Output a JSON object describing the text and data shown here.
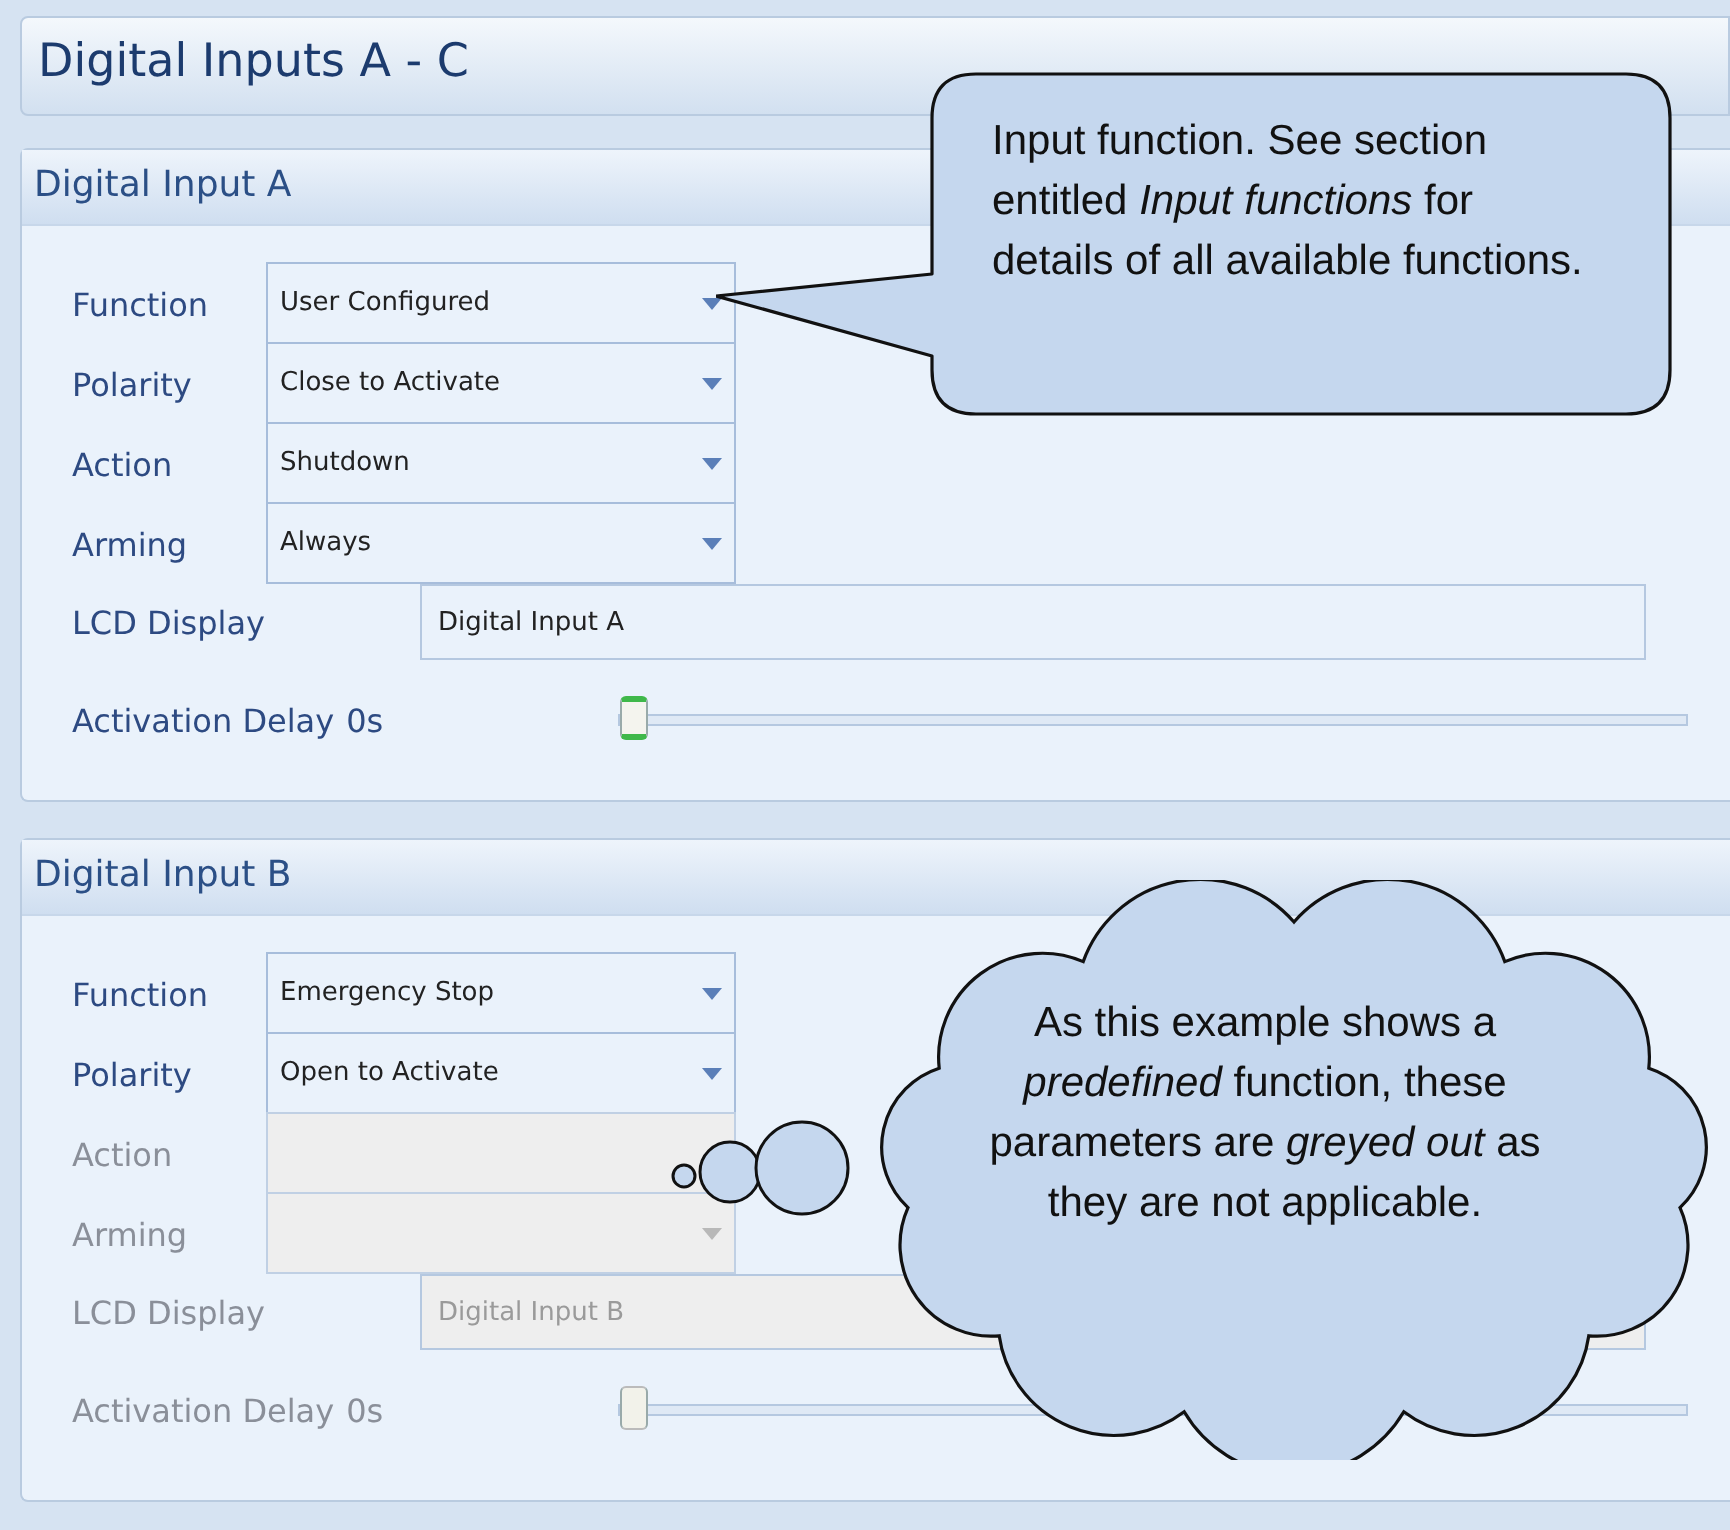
{
  "title": "Digital Inputs A - C",
  "panels": [
    {
      "title": "Digital Input A",
      "fields": [
        {
          "label": "Function",
          "value": "User Configured",
          "disabled": false
        },
        {
          "label": "Polarity",
          "value": "Close to Activate",
          "disabled": false
        },
        {
          "label": "Action",
          "value": "Shutdown",
          "disabled": false
        },
        {
          "label": "Arming",
          "value": "Always",
          "disabled": false
        }
      ],
      "lcd": {
        "label": "LCD Display",
        "value": "Digital Input A",
        "disabled": false
      },
      "delay": {
        "label": "Activation Delay",
        "reading": "0s",
        "level": 0,
        "disabled": false
      }
    },
    {
      "title": "Digital Input B",
      "fields": [
        {
          "label": "Function",
          "value": "Emergency Stop",
          "disabled": false
        },
        {
          "label": "Polarity",
          "value": "Open to Activate",
          "disabled": false
        },
        {
          "label": "Action",
          "disabled": true
        },
        {
          "label": "Arming",
          "disabled": true
        }
      ],
      "lcd": {
        "label": "LCD Display",
        "value": "Digital Input B",
        "disabled": true
      },
      "delay": {
        "label": "Activation Delay",
        "reading": "0s",
        "level": 0,
        "disabled": true
      }
    }
  ],
  "callouts": [
    {
      "kind": "speech",
      "text": "Input function. See section entitled *Input functions* for details of all available functions."
    },
    {
      "kind": "thought",
      "text": "As this example shows a *predefined* function, these parameters are *greyed out* as they are not applicable."
    }
  ]
}
